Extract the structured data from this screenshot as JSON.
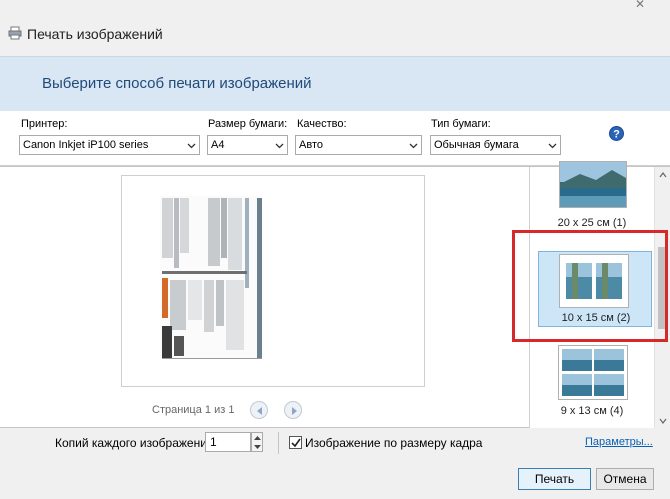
{
  "window": {
    "title": "Печать изображений",
    "close_icon": "close-icon"
  },
  "header": {
    "text": "Выберите способ печати изображений"
  },
  "options": {
    "printer": {
      "label": "Принтер:",
      "value": "Canon Inkjet iP100 series"
    },
    "paper_size": {
      "label": "Размер бумаги:",
      "value": "A4"
    },
    "quality": {
      "label": "Качество:",
      "value": "Авто"
    },
    "paper_type": {
      "label": "Тип бумаги:",
      "value": "Обычная бумага"
    },
    "help_icon": "help-icon"
  },
  "preview": {
    "page_label": "Страница 1 из 1"
  },
  "layouts": [
    {
      "label": "20 x 25 см (1)",
      "selected": false
    },
    {
      "label": "10 x 15 см (2)",
      "selected": true
    },
    {
      "label": "9 x 13 см (4)",
      "selected": false
    }
  ],
  "footer": {
    "copies_label": "Копий каждого изображения:",
    "copies_value": "1",
    "fit_label": "Изображение по размеру кадра",
    "fit_checked": true,
    "options_link": "Параметры...",
    "print_button": "Печать",
    "cancel_button": "Отмена"
  },
  "colors": {
    "header_bg": "#d9e6f3",
    "highlight": "#d62a2a",
    "link": "#0b5fb3"
  }
}
